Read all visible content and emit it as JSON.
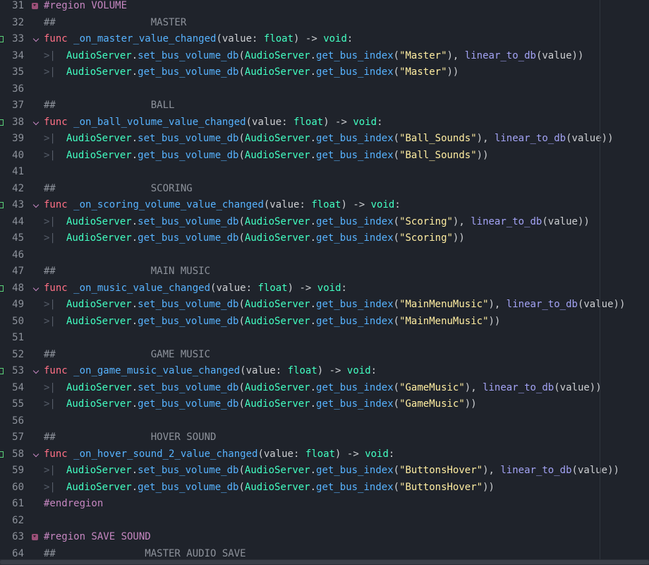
{
  "editor": {
    "lines": [
      {
        "n": "31",
        "fold": true,
        "connector": false,
        "tabs": 0,
        "tokens": [
          {
            "t": "#region VOLUME",
            "c": "reg"
          }
        ]
      },
      {
        "n": "32",
        "fold": false,
        "connector": false,
        "tabs": 0,
        "tokens": [
          {
            "t": "##                MASTER",
            "c": "cmt"
          }
        ]
      },
      {
        "n": "33",
        "fold": false,
        "connector": true,
        "tabs": 0,
        "tokens": [
          {
            "t": "func",
            "c": "kw"
          },
          {
            "t": " ",
            "c": "pl"
          },
          {
            "t": "_on_master_value_changed",
            "c": "fn"
          },
          {
            "t": "(value: ",
            "c": "pl"
          },
          {
            "t": "float",
            "c": "tp"
          },
          {
            "t": ") -> ",
            "c": "pl"
          },
          {
            "t": "void",
            "c": "tp"
          },
          {
            "t": ":",
            "c": "pl"
          }
        ]
      },
      {
        "n": "34",
        "fold": false,
        "connector": false,
        "tabs": 1,
        "tokens": [
          {
            "t": "AudioServer",
            "c": "cls"
          },
          {
            "t": ".",
            "c": "pl"
          },
          {
            "t": "set_bus_volume_db",
            "c": "fn"
          },
          {
            "t": "(",
            "c": "pl"
          },
          {
            "t": "AudioServer",
            "c": "cls"
          },
          {
            "t": ".",
            "c": "pl"
          },
          {
            "t": "get_bus_index",
            "c": "fn"
          },
          {
            "t": "(",
            "c": "pl"
          },
          {
            "t": "\"Master\"",
            "c": "str"
          },
          {
            "t": "), ",
            "c": "pl"
          },
          {
            "t": "linear_to_db",
            "c": "bfn"
          },
          {
            "t": "(value))",
            "c": "pl"
          }
        ]
      },
      {
        "n": "35",
        "fold": false,
        "connector": false,
        "tabs": 1,
        "tokens": [
          {
            "t": "AudioServer",
            "c": "cls"
          },
          {
            "t": ".",
            "c": "pl"
          },
          {
            "t": "get_bus_volume_db",
            "c": "fn"
          },
          {
            "t": "(",
            "c": "pl"
          },
          {
            "t": "AudioServer",
            "c": "cls"
          },
          {
            "t": ".",
            "c": "pl"
          },
          {
            "t": "get_bus_index",
            "c": "fn"
          },
          {
            "t": "(",
            "c": "pl"
          },
          {
            "t": "\"Master\"",
            "c": "str"
          },
          {
            "t": "))",
            "c": "pl"
          }
        ]
      },
      {
        "n": "36",
        "fold": false,
        "connector": false,
        "tabs": 0,
        "tokens": []
      },
      {
        "n": "37",
        "fold": false,
        "connector": false,
        "tabs": 0,
        "tokens": [
          {
            "t": "##                BALL",
            "c": "cmt"
          }
        ]
      },
      {
        "n": "38",
        "fold": false,
        "connector": true,
        "tabs": 0,
        "tokens": [
          {
            "t": "func",
            "c": "kw"
          },
          {
            "t": " ",
            "c": "pl"
          },
          {
            "t": "_on_ball_volume_value_changed",
            "c": "fn"
          },
          {
            "t": "(value: ",
            "c": "pl"
          },
          {
            "t": "float",
            "c": "tp"
          },
          {
            "t": ") -> ",
            "c": "pl"
          },
          {
            "t": "void",
            "c": "tp"
          },
          {
            "t": ":",
            "c": "pl"
          }
        ]
      },
      {
        "n": "39",
        "fold": false,
        "connector": false,
        "tabs": 1,
        "tokens": [
          {
            "t": "AudioServer",
            "c": "cls"
          },
          {
            "t": ".",
            "c": "pl"
          },
          {
            "t": "set_bus_volume_db",
            "c": "fn"
          },
          {
            "t": "(",
            "c": "pl"
          },
          {
            "t": "AudioServer",
            "c": "cls"
          },
          {
            "t": ".",
            "c": "pl"
          },
          {
            "t": "get_bus_index",
            "c": "fn"
          },
          {
            "t": "(",
            "c": "pl"
          },
          {
            "t": "\"Ball_Sounds\"",
            "c": "str"
          },
          {
            "t": "), ",
            "c": "pl"
          },
          {
            "t": "linear_to_db",
            "c": "bfn"
          },
          {
            "t": "(value))",
            "c": "pl"
          }
        ]
      },
      {
        "n": "40",
        "fold": false,
        "connector": false,
        "tabs": 1,
        "tokens": [
          {
            "t": "AudioServer",
            "c": "cls"
          },
          {
            "t": ".",
            "c": "pl"
          },
          {
            "t": "get_bus_volume_db",
            "c": "fn"
          },
          {
            "t": "(",
            "c": "pl"
          },
          {
            "t": "AudioServer",
            "c": "cls"
          },
          {
            "t": ".",
            "c": "pl"
          },
          {
            "t": "get_bus_index",
            "c": "fn"
          },
          {
            "t": "(",
            "c": "pl"
          },
          {
            "t": "\"Ball_Sounds\"",
            "c": "str"
          },
          {
            "t": "))",
            "c": "pl"
          }
        ]
      },
      {
        "n": "41",
        "fold": false,
        "connector": false,
        "tabs": 0,
        "tokens": []
      },
      {
        "n": "42",
        "fold": false,
        "connector": false,
        "tabs": 0,
        "tokens": [
          {
            "t": "##                SCORING",
            "c": "cmt"
          }
        ]
      },
      {
        "n": "43",
        "fold": false,
        "connector": true,
        "tabs": 0,
        "tokens": [
          {
            "t": "func",
            "c": "kw"
          },
          {
            "t": " ",
            "c": "pl"
          },
          {
            "t": "_on_scoring_volume_value_changed",
            "c": "fn"
          },
          {
            "t": "(value: ",
            "c": "pl"
          },
          {
            "t": "float",
            "c": "tp"
          },
          {
            "t": ") -> ",
            "c": "pl"
          },
          {
            "t": "void",
            "c": "tp"
          },
          {
            "t": ":",
            "c": "pl"
          }
        ]
      },
      {
        "n": "44",
        "fold": false,
        "connector": false,
        "tabs": 1,
        "tokens": [
          {
            "t": "AudioServer",
            "c": "cls"
          },
          {
            "t": ".",
            "c": "pl"
          },
          {
            "t": "set_bus_volume_db",
            "c": "fn"
          },
          {
            "t": "(",
            "c": "pl"
          },
          {
            "t": "AudioServer",
            "c": "cls"
          },
          {
            "t": ".",
            "c": "pl"
          },
          {
            "t": "get_bus_index",
            "c": "fn"
          },
          {
            "t": "(",
            "c": "pl"
          },
          {
            "t": "\"Scoring\"",
            "c": "str"
          },
          {
            "t": "), ",
            "c": "pl"
          },
          {
            "t": "linear_to_db",
            "c": "bfn"
          },
          {
            "t": "(value))",
            "c": "pl"
          }
        ]
      },
      {
        "n": "45",
        "fold": false,
        "connector": false,
        "tabs": 1,
        "tokens": [
          {
            "t": "AudioServer",
            "c": "cls"
          },
          {
            "t": ".",
            "c": "pl"
          },
          {
            "t": "get_bus_volume_db",
            "c": "fn"
          },
          {
            "t": "(",
            "c": "pl"
          },
          {
            "t": "AudioServer",
            "c": "cls"
          },
          {
            "t": ".",
            "c": "pl"
          },
          {
            "t": "get_bus_index",
            "c": "fn"
          },
          {
            "t": "(",
            "c": "pl"
          },
          {
            "t": "\"Scoring\"",
            "c": "str"
          },
          {
            "t": "))",
            "c": "pl"
          }
        ]
      },
      {
        "n": "46",
        "fold": false,
        "connector": false,
        "tabs": 0,
        "tokens": []
      },
      {
        "n": "47",
        "fold": false,
        "connector": false,
        "tabs": 0,
        "tokens": [
          {
            "t": "##                MAIN MUSIC",
            "c": "cmt"
          }
        ]
      },
      {
        "n": "48",
        "fold": false,
        "connector": true,
        "tabs": 0,
        "tokens": [
          {
            "t": "func",
            "c": "kw"
          },
          {
            "t": " ",
            "c": "pl"
          },
          {
            "t": "_on_music_value_changed",
            "c": "fn"
          },
          {
            "t": "(value: ",
            "c": "pl"
          },
          {
            "t": "float",
            "c": "tp"
          },
          {
            "t": ") -> ",
            "c": "pl"
          },
          {
            "t": "void",
            "c": "tp"
          },
          {
            "t": ":",
            "c": "pl"
          }
        ]
      },
      {
        "n": "49",
        "fold": false,
        "connector": false,
        "tabs": 1,
        "tokens": [
          {
            "t": "AudioServer",
            "c": "cls"
          },
          {
            "t": ".",
            "c": "pl"
          },
          {
            "t": "set_bus_volume_db",
            "c": "fn"
          },
          {
            "t": "(",
            "c": "pl"
          },
          {
            "t": "AudioServer",
            "c": "cls"
          },
          {
            "t": ".",
            "c": "pl"
          },
          {
            "t": "get_bus_index",
            "c": "fn"
          },
          {
            "t": "(",
            "c": "pl"
          },
          {
            "t": "\"MainMenuMusic\"",
            "c": "str"
          },
          {
            "t": "), ",
            "c": "pl"
          },
          {
            "t": "linear_to_db",
            "c": "bfn"
          },
          {
            "t": "(value))",
            "c": "pl"
          }
        ]
      },
      {
        "n": "50",
        "fold": false,
        "connector": false,
        "tabs": 1,
        "tokens": [
          {
            "t": "AudioServer",
            "c": "cls"
          },
          {
            "t": ".",
            "c": "pl"
          },
          {
            "t": "get_bus_volume_db",
            "c": "fn"
          },
          {
            "t": "(",
            "c": "pl"
          },
          {
            "t": "AudioServer",
            "c": "cls"
          },
          {
            "t": ".",
            "c": "pl"
          },
          {
            "t": "get_bus_index",
            "c": "fn"
          },
          {
            "t": "(",
            "c": "pl"
          },
          {
            "t": "\"MainMenuMusic\"",
            "c": "str"
          },
          {
            "t": "))",
            "c": "pl"
          }
        ]
      },
      {
        "n": "51",
        "fold": false,
        "connector": false,
        "tabs": 0,
        "tokens": []
      },
      {
        "n": "52",
        "fold": false,
        "connector": false,
        "tabs": 0,
        "tokens": [
          {
            "t": "##                GAME MUSIC",
            "c": "cmt"
          }
        ]
      },
      {
        "n": "53",
        "fold": false,
        "connector": true,
        "tabs": 0,
        "tokens": [
          {
            "t": "func",
            "c": "kw"
          },
          {
            "t": " ",
            "c": "pl"
          },
          {
            "t": "_on_game_music_value_changed",
            "c": "fn"
          },
          {
            "t": "(value: ",
            "c": "pl"
          },
          {
            "t": "float",
            "c": "tp"
          },
          {
            "t": ") -> ",
            "c": "pl"
          },
          {
            "t": "void",
            "c": "tp"
          },
          {
            "t": ":",
            "c": "pl"
          }
        ]
      },
      {
        "n": "54",
        "fold": false,
        "connector": false,
        "tabs": 1,
        "tokens": [
          {
            "t": "AudioServer",
            "c": "cls"
          },
          {
            "t": ".",
            "c": "pl"
          },
          {
            "t": "set_bus_volume_db",
            "c": "fn"
          },
          {
            "t": "(",
            "c": "pl"
          },
          {
            "t": "AudioServer",
            "c": "cls"
          },
          {
            "t": ".",
            "c": "pl"
          },
          {
            "t": "get_bus_index",
            "c": "fn"
          },
          {
            "t": "(",
            "c": "pl"
          },
          {
            "t": "\"GameMusic\"",
            "c": "str"
          },
          {
            "t": "), ",
            "c": "pl"
          },
          {
            "t": "linear_to_db",
            "c": "bfn"
          },
          {
            "t": "(value))",
            "c": "pl"
          }
        ]
      },
      {
        "n": "55",
        "fold": false,
        "connector": false,
        "tabs": 1,
        "tokens": [
          {
            "t": "AudioServer",
            "c": "cls"
          },
          {
            "t": ".",
            "c": "pl"
          },
          {
            "t": "get_bus_volume_db",
            "c": "fn"
          },
          {
            "t": "(",
            "c": "pl"
          },
          {
            "t": "AudioServer",
            "c": "cls"
          },
          {
            "t": ".",
            "c": "pl"
          },
          {
            "t": "get_bus_index",
            "c": "fn"
          },
          {
            "t": "(",
            "c": "pl"
          },
          {
            "t": "\"GameMusic\"",
            "c": "str"
          },
          {
            "t": "))",
            "c": "pl"
          }
        ]
      },
      {
        "n": "56",
        "fold": false,
        "connector": false,
        "tabs": 0,
        "tokens": []
      },
      {
        "n": "57",
        "fold": false,
        "connector": false,
        "tabs": 0,
        "tokens": [
          {
            "t": "##                HOVER SOUND",
            "c": "cmt"
          }
        ]
      },
      {
        "n": "58",
        "fold": false,
        "connector": true,
        "tabs": 0,
        "tokens": [
          {
            "t": "func",
            "c": "kw"
          },
          {
            "t": " ",
            "c": "pl"
          },
          {
            "t": "_on_hover_sound_2_value_changed",
            "c": "fn"
          },
          {
            "t": "(value: ",
            "c": "pl"
          },
          {
            "t": "float",
            "c": "tp"
          },
          {
            "t": ") -> ",
            "c": "pl"
          },
          {
            "t": "void",
            "c": "tp"
          },
          {
            "t": ":",
            "c": "pl"
          }
        ]
      },
      {
        "n": "59",
        "fold": false,
        "connector": false,
        "tabs": 1,
        "tokens": [
          {
            "t": "AudioServer",
            "c": "cls"
          },
          {
            "t": ".",
            "c": "pl"
          },
          {
            "t": "set_bus_volume_db",
            "c": "fn"
          },
          {
            "t": "(",
            "c": "pl"
          },
          {
            "t": "AudioServer",
            "c": "cls"
          },
          {
            "t": ".",
            "c": "pl"
          },
          {
            "t": "get_bus_index",
            "c": "fn"
          },
          {
            "t": "(",
            "c": "pl"
          },
          {
            "t": "\"ButtonsHover\"",
            "c": "str"
          },
          {
            "t": "), ",
            "c": "pl"
          },
          {
            "t": "linear_to_db",
            "c": "bfn"
          },
          {
            "t": "(value))",
            "c": "pl"
          }
        ]
      },
      {
        "n": "60",
        "fold": false,
        "connector": false,
        "tabs": 1,
        "tokens": [
          {
            "t": "AudioServer",
            "c": "cls"
          },
          {
            "t": ".",
            "c": "pl"
          },
          {
            "t": "get_bus_volume_db",
            "c": "fn"
          },
          {
            "t": "(",
            "c": "pl"
          },
          {
            "t": "AudioServer",
            "c": "cls"
          },
          {
            "t": ".",
            "c": "pl"
          },
          {
            "t": "get_bus_index",
            "c": "fn"
          },
          {
            "t": "(",
            "c": "pl"
          },
          {
            "t": "\"ButtonsHover\"",
            "c": "str"
          },
          {
            "t": "))",
            "c": "pl"
          }
        ]
      },
      {
        "n": "61",
        "fold": false,
        "connector": false,
        "tabs": 0,
        "tokens": [
          {
            "t": "#endregion",
            "c": "reg"
          }
        ]
      },
      {
        "n": "62",
        "fold": false,
        "connector": false,
        "tabs": 0,
        "tokens": []
      },
      {
        "n": "63",
        "fold": true,
        "connector": false,
        "tabs": 0,
        "tokens": [
          {
            "t": "#region SAVE SOUND",
            "c": "reg"
          }
        ]
      },
      {
        "n": "64",
        "fold": false,
        "connector": false,
        "tabs": 0,
        "tokens": [
          {
            "t": "##               MASTER AUDIO SAVE",
            "c": "cmt"
          }
        ]
      }
    ]
  }
}
